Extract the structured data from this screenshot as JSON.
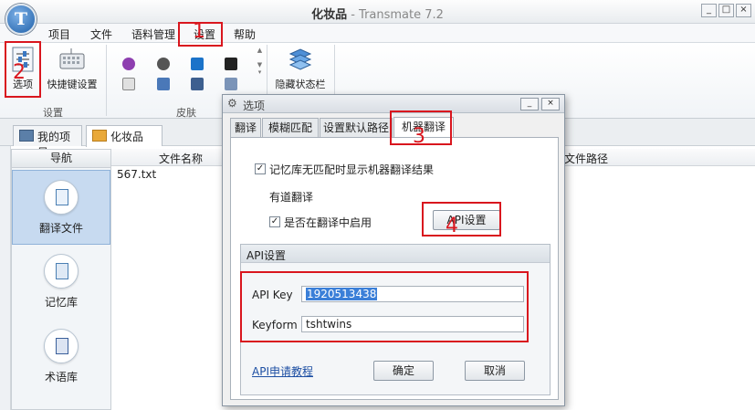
{
  "window": {
    "title": "化妆品",
    "app_name": "- Transmate 7.2",
    "minimize": "_",
    "maximize": "□",
    "close": "×",
    "logo_letter": "T"
  },
  "menu": [
    "项目",
    "文件",
    "语料管理",
    "设置",
    "帮助"
  ],
  "ribbon": {
    "options_label": "选项",
    "shortcut_label": "快捷键设置",
    "group_settings": "设置",
    "group_skin": "皮肤",
    "hide_status_label": "隐藏状态栏"
  },
  "doc_tabs": {
    "my_projects": "我的项目",
    "active_doc": "化妆品",
    "close": "×"
  },
  "nav": {
    "header": "导航",
    "items": [
      "翻译文件",
      "记忆库",
      "术语库"
    ]
  },
  "files": {
    "col_name": "文件名称",
    "col_path": "文件路径",
    "rows": [
      "567.txt"
    ]
  },
  "dialog": {
    "title": "选项",
    "tabs": [
      "翻译",
      "模糊匹配",
      "设置默认路径",
      "机器翻译"
    ],
    "active_tab": 3,
    "chk_show_mt": "记忆库无匹配时显示机器翻译结果",
    "youdao_label": "有道翻译",
    "chk_enable": "是否在翻译中启用",
    "api_settings_btn": "API设置",
    "api_group_title": "API设置",
    "api_key_label": "API Key",
    "api_key_value": "1920513438",
    "keyform_label": "Keyform",
    "keyform_value": "tshtwins",
    "api_link": "API申请教程",
    "ok": "确定",
    "cancel": "取消"
  },
  "annotations": [
    "1",
    "2",
    "3",
    "4"
  ],
  "colors": {
    "annotation_red": "#d9161e",
    "selection_blue": "#3b7fd8",
    "nav_active": "#c7daf0"
  }
}
